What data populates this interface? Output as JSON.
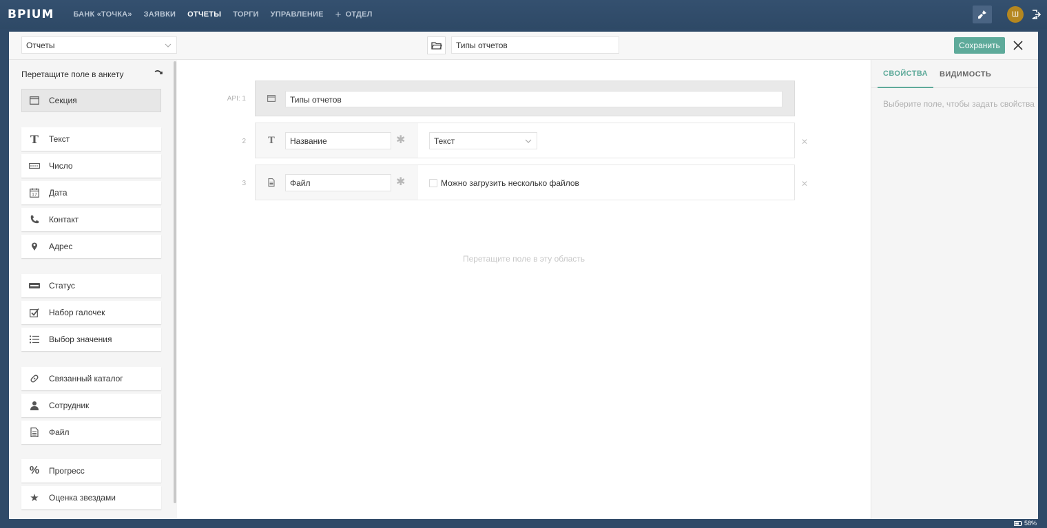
{
  "app": {
    "logo": "BPIUM",
    "nav": [
      {
        "label": "БАНК «ТОЧКА»",
        "active": false
      },
      {
        "label": "ЗАЯВКИ",
        "active": false
      },
      {
        "label": "ОТЧЕТЫ",
        "active": true
      },
      {
        "label": "ТОРГИ",
        "active": false
      },
      {
        "label": "УПРАВЛЕНИЕ",
        "active": false
      }
    ],
    "nav_add_label": "ОТДЕЛ",
    "avatar_initial": "Ш"
  },
  "editor": {
    "catalog_select": "Отчеты",
    "catalog_title": "Типы отчетов",
    "save_label": "Сохранить"
  },
  "palette": {
    "title": "Перетащите поле в анкету",
    "items": [
      {
        "label": "Секция",
        "icon": "section-icon"
      },
      {
        "label": "Текст",
        "icon": "text-icon"
      },
      {
        "label": "Число",
        "icon": "number-icon"
      },
      {
        "label": "Дата",
        "icon": "calendar-icon"
      },
      {
        "label": "Контакт",
        "icon": "phone-icon"
      },
      {
        "label": "Адрес",
        "icon": "map-pin-icon"
      },
      {
        "label": "Статус",
        "icon": "status-icon"
      },
      {
        "label": "Набор галочек",
        "icon": "checkbox-icon"
      },
      {
        "label": "Выбор значения",
        "icon": "list-icon"
      },
      {
        "label": "Связанный каталог",
        "icon": "link-icon"
      },
      {
        "label": "Сотрудник",
        "icon": "user-icon"
      },
      {
        "label": "Файл",
        "icon": "file-icon"
      },
      {
        "label": "Прогресс",
        "icon": "percent-icon"
      },
      {
        "label": "Оценка звездами",
        "icon": "star-icon"
      }
    ]
  },
  "canvas": {
    "fields": [
      {
        "num": "API: 1",
        "value": "Типы отчетов"
      },
      {
        "num": "2",
        "value": "Название",
        "type_value": "Текст"
      },
      {
        "num": "3",
        "value": "Файл",
        "checkbox_label": "Можно загрузить несколько файлов"
      }
    ],
    "drop_hint": "Перетащите поле в эту область"
  },
  "props": {
    "tabs": [
      "СВОЙСТВА",
      "ВИДИМОСТЬ"
    ],
    "hint": "Выберите поле, чтобы задать свойства"
  },
  "status": {
    "battery": "58%"
  },
  "colors": {
    "topbar": "#2f4a68",
    "accent": "#5eaa9a",
    "avatar": "#b5871f"
  }
}
